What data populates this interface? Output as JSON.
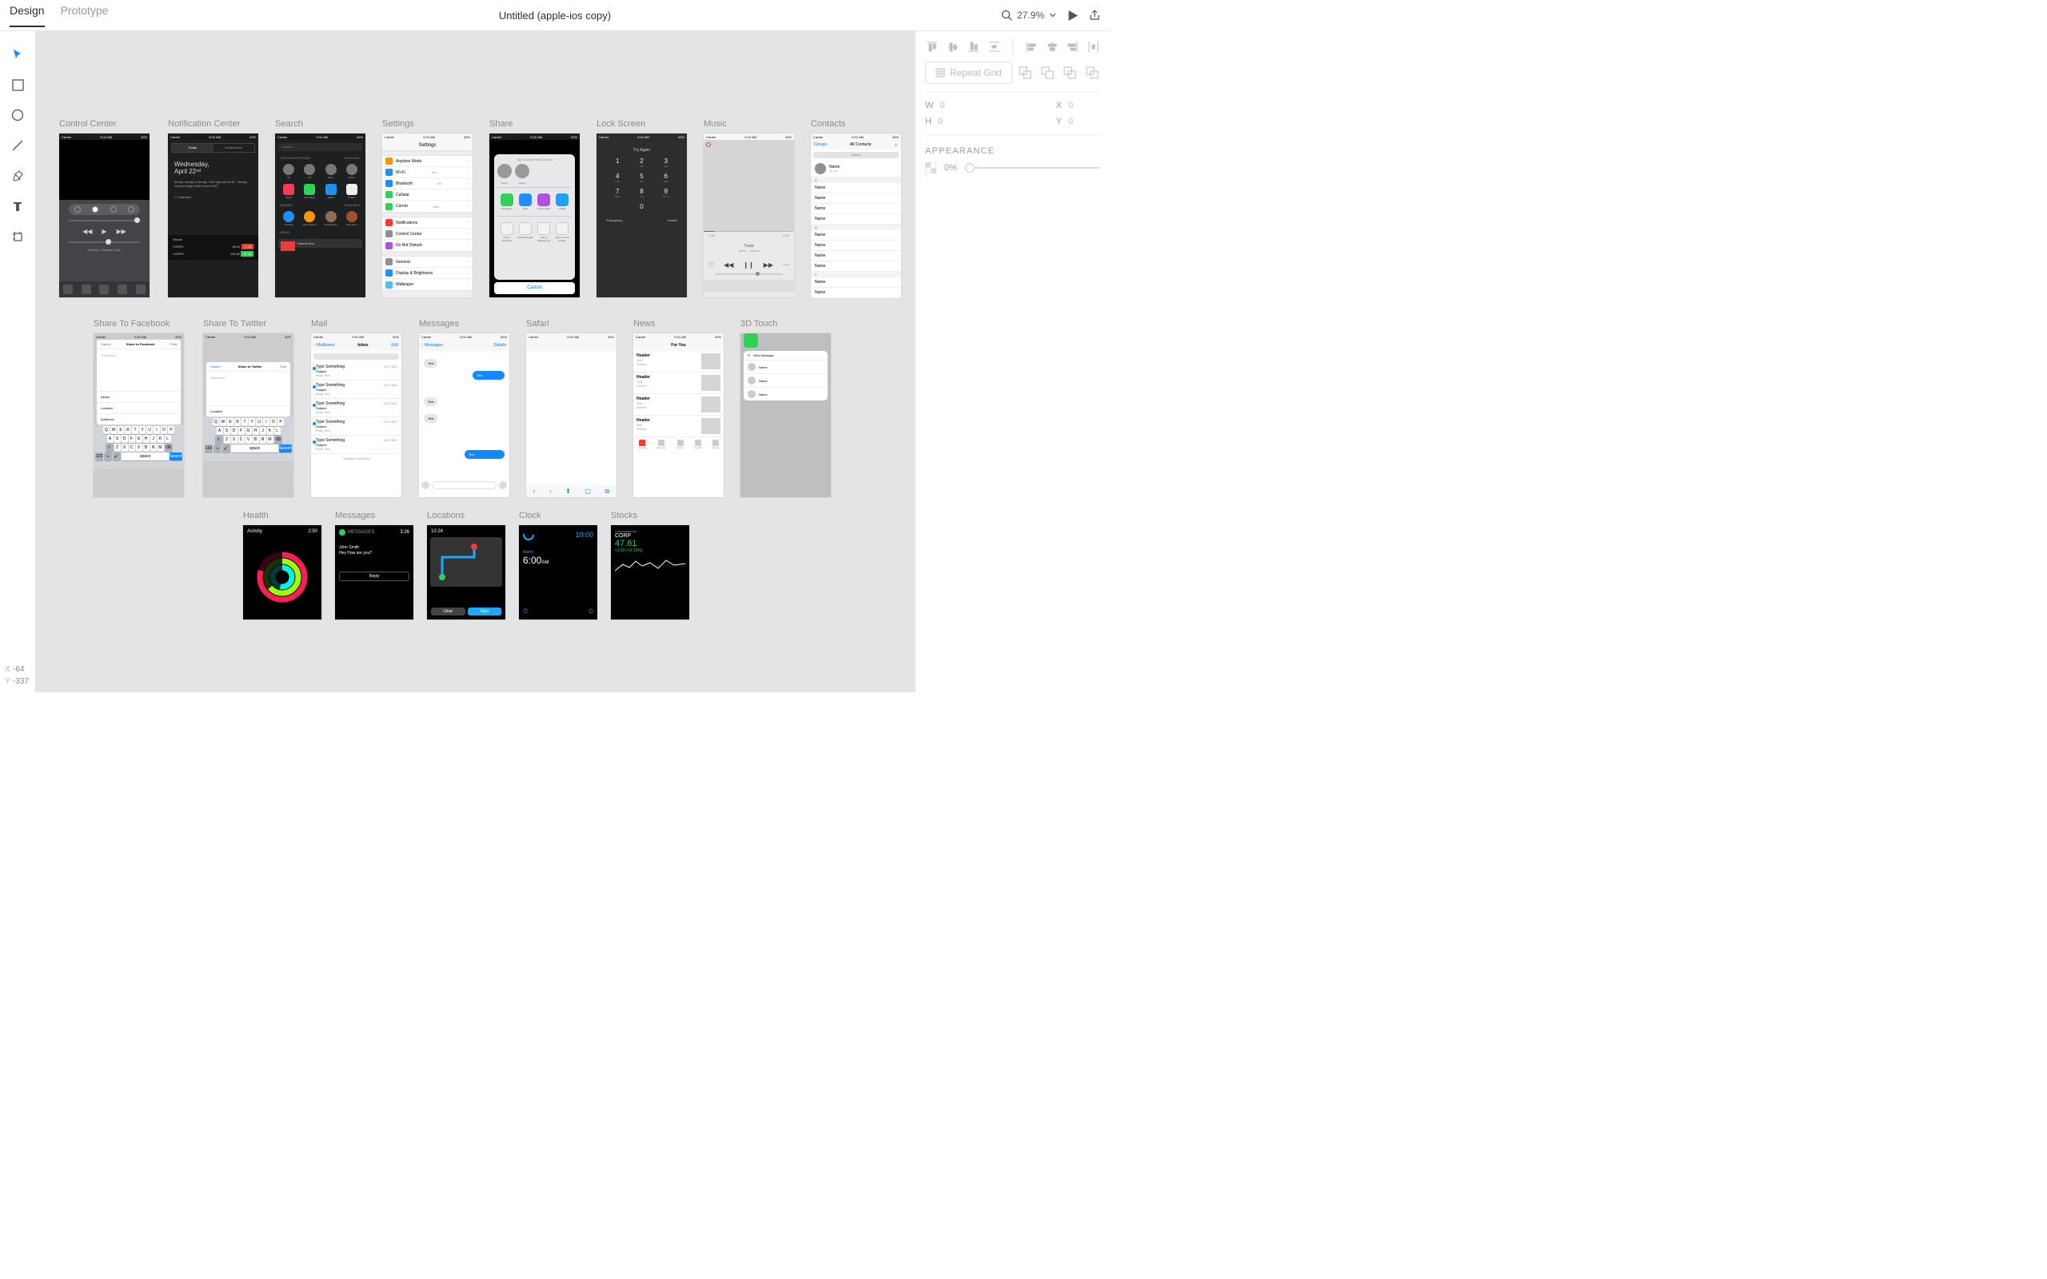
{
  "topbar": {
    "tabs": [
      "Design",
      "Prototype"
    ],
    "title": "Untitled (apple-ios copy)",
    "zoom": "27.9%"
  },
  "rightpanel": {
    "repeat_grid": "Repeat Grid",
    "dims": {
      "w_label": "W",
      "w": "0",
      "x_label": "X",
      "x": "0",
      "h_label": "H",
      "h": "0",
      "y_label": "Y",
      "y": "0"
    },
    "appearance": {
      "label": "APPEARANCE",
      "opacity": "0%"
    }
  },
  "footer": {
    "x_label": "X",
    "x": "-64",
    "y_label": "Y",
    "y": "-337"
  },
  "artboard_labels": {
    "control_center": "Control Center",
    "notification_center": "Notification Center",
    "search": "Search",
    "settings": "Settings",
    "share": "Share",
    "lock_screen": "Lock Screen",
    "music": "Music",
    "contacts": "Contacts",
    "share_fb": "Share To Facebook",
    "share_tw": "Share To Twitter",
    "mail": "Mail",
    "messages": "Messages",
    "safari": "Safari",
    "news": "News",
    "touch3d": "3D Touch",
    "health": "Health",
    "messages2": "Messages",
    "locations": "Locations",
    "clock": "Clock",
    "stocks": "Stocks"
  },
  "status": {
    "carrier": "Carrier",
    "time": "9:41 AM",
    "battery": "42%"
  },
  "control_center": {
    "airdrop": "AirDrop: Contacts Only"
  },
  "notification_center": {
    "tabs": [
      "Today",
      "Notifications"
    ],
    "day": "Wednesday,",
    "date": "April 22ⁿᵈ",
    "weather": "Mostly cloudy currently. The high will be 61°. Mostly cloudy tonight with a low of 46°.",
    "calendar": "Calendar",
    "stocks_header": "Stocks",
    "stocks": [
      {
        "sym": "CORP1",
        "price": "80.87",
        "chg": "-1.43",
        "dir": "down"
      },
      {
        "sym": "CORP2",
        "price": "126.62",
        "chg": "+1.11",
        "dir": "up"
      }
    ]
  },
  "search": {
    "placeholder": "Search",
    "sections": {
      "siri": "SIRI SUGGESTIONS",
      "more": "Show More",
      "nearby": "NEARBY",
      "news": "NEWS"
    },
    "siri": [
      {
        "n": "AA"
      },
      {
        "n": "AA"
      },
      {
        "n": "Name"
      },
      {
        "n": "Name"
      }
    ],
    "apps": [
      {
        "n": "Music",
        "c": "#ff3b53"
      },
      {
        "n": "Messages",
        "c": "#30d158"
      },
      {
        "n": "Safari",
        "c": "#1f8fff"
      },
      {
        "n": "Photos",
        "c": "#eee"
      }
    ],
    "nearby": [
      {
        "n": "Parking",
        "c": "#1f8fff"
      },
      {
        "n": "Gas Stations",
        "c": "#ff9500"
      },
      {
        "n": "Restaurants",
        "c": "#8e6c5a"
      },
      {
        "n": "Fast Food",
        "c": "#a0522d"
      }
    ],
    "news_header": "Header text"
  },
  "settings": {
    "title": "Settings",
    "g1": [
      {
        "t": "Airplane Mode",
        "c": "#ff9500"
      },
      {
        "t": "Wi-Fi",
        "c": "#1f8fff",
        "v": "Wi-..."
      },
      {
        "t": "Bluetooth",
        "c": "#1f8fff",
        "v": "On"
      },
      {
        "t": "Cellular",
        "c": "#30d158"
      },
      {
        "t": "Carrier",
        "c": "#30d158",
        "v": "Carr..."
      }
    ],
    "g2": [
      {
        "t": "Notifications",
        "c": "#ff3b30"
      },
      {
        "t": "Control Center",
        "c": "#8e8e93"
      },
      {
        "t": "Do Not Disturb",
        "c": "#af52de"
      }
    ],
    "g3": [
      {
        "t": "General",
        "c": "#8e8e93"
      },
      {
        "t": "Display & Brightness",
        "c": "#1f8fff"
      },
      {
        "t": "Wallpaper",
        "c": "#55bef0"
      }
    ]
  },
  "share": {
    "title": "Tap to share with AirDrop",
    "people": [
      {
        "n": "Name",
        "s": "MacBook Pro"
      },
      {
        "n": "Name",
        "s": "MacBook Pro"
      }
    ],
    "apps": [
      {
        "n": "Messages",
        "c": "#30d158"
      },
      {
        "n": "Mail",
        "c": "#1f8fff"
      },
      {
        "n": "iTunes Store",
        "c": "#af52de"
      },
      {
        "n": "Twitter",
        "c": "#1da1f2"
      }
    ],
    "actions": [
      {
        "n": "Add to Favorites"
      },
      {
        "n": "Add Bookmark"
      },
      {
        "n": "Add to Reading List"
      },
      {
        "n": "Add to Home Screen"
      }
    ],
    "cancel": "Cancel"
  },
  "lock_screen": {
    "try": "Try Again",
    "keys": [
      [
        "1",
        ""
      ],
      [
        "2",
        "ABC"
      ],
      [
        "3",
        "DEF"
      ],
      [
        "4",
        "GHI"
      ],
      [
        "5",
        "JKL"
      ],
      [
        "6",
        "MNO"
      ],
      [
        "7",
        "PQRS"
      ],
      [
        "8",
        "TUV"
      ],
      [
        "9",
        "WXYZ"
      ],
      [
        "",
        ""
      ],
      [
        "0",
        ""
      ],
      [
        "",
        ""
      ]
    ],
    "emergency": "Emergency",
    "cancel": "Cancel"
  },
  "music": {
    "track": "Track",
    "artist": "Artist — Album",
    "t1": "0:34",
    "t2": "-3:25"
  },
  "contacts": {
    "groups": "Groups",
    "title": "All Contacts",
    "add": "＋",
    "search": "Search",
    "me": {
      "name": "Name",
      "sub": "My Card"
    },
    "index": [
      "A",
      "B",
      "C"
    ],
    "row": "Name"
  },
  "share_fb": {
    "cancel": "Cancel",
    "title": "Share to Facebook",
    "post": "Post",
    "placeholder": "Share text...",
    "opts": [
      "Album",
      "Location",
      "Audience"
    ]
  },
  "share_tw": {
    "cancel": "Cancel",
    "title": "Share to Twitter",
    "post": "Post",
    "placeholder": "Share text...",
    "opts": [
      "Location"
    ]
  },
  "keyboard": {
    "row1": [
      "Q",
      "W",
      "E",
      "R",
      "T",
      "Y",
      "U",
      "I",
      "O",
      "P"
    ],
    "row2": [
      "A",
      "S",
      "D",
      "F",
      "G",
      "H",
      "J",
      "K",
      "L"
    ],
    "row3": [
      "Z",
      "X",
      "C",
      "V",
      "B",
      "N",
      "M"
    ],
    "space": "space",
    "search": "Search",
    "num": "123"
  },
  "mail": {
    "back": "Mailboxes",
    "title": "Inbox",
    "edit": "Edit",
    "rows": [
      {
        "s": "Type Something",
        "sub": "Subject",
        "p": "Body Text",
        "t": "10:47 AM"
      },
      {
        "s": "Type Something",
        "sub": "Subject",
        "p": "Body Text",
        "t": "10:47 AM"
      },
      {
        "s": "Type Something",
        "sub": "Subject",
        "p": "Body Text",
        "t": "10:47 AM"
      },
      {
        "s": "Type Something",
        "sub": "Subject",
        "p": "Body Text",
        "t": "10:47 AM"
      },
      {
        "s": "Type Something",
        "sub": "Subject",
        "p": "Body Text",
        "t": "10:47 AM"
      }
    ],
    "footer": "Updated Just Now"
  },
  "messages": {
    "back": "Messages",
    "details": "Details",
    "bubbles": [
      "Text",
      "Text",
      "Text",
      "Text",
      "Text"
    ]
  },
  "news": {
    "title": "For You",
    "rows": [
      {
        "h": "Header",
        "t": "Text",
        "s": "Source"
      },
      {
        "h": "Header",
        "t": "Text",
        "s": "Source"
      },
      {
        "h": "Header",
        "t": "Text",
        "s": "Source"
      },
      {
        "h": "Header",
        "t": "Text",
        "s": "Source"
      }
    ],
    "tabs": [
      "For You",
      "Favorites",
      "Explore",
      "Search",
      "Saved"
    ]
  },
  "touch3d": {
    "new": "New Message",
    "rows": [
      "Name",
      "Name",
      "Name"
    ]
  },
  "watch": {
    "health": {
      "title": "Activity",
      "time": "2:50"
    },
    "messages": {
      "title": "MESSAGES",
      "time": "3:26",
      "from": "John Smith",
      "text": "Hey How are you?",
      "reply": "Reply"
    },
    "locations": {
      "time": "10:24",
      "clear": "Clear",
      "start": "Start"
    },
    "clock": {
      "time": "10:00",
      "alarm": "Alarm",
      "atime": "6:00",
      "ampm": "AM"
    },
    "stocks": {
      "co": "Corporation Inc.",
      "sym": "CORP",
      "price": "47.61",
      "change": "+1.02 (+2.19%)"
    }
  }
}
